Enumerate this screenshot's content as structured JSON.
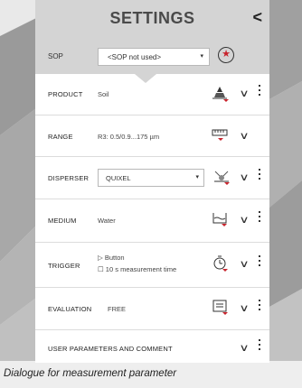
{
  "header": {
    "title": "SETTINGS",
    "back_label": "<"
  },
  "sop": {
    "label": "SOP",
    "value": "<SOP not used>",
    "arrow": "▾"
  },
  "rows": [
    {
      "label": "PRODUCT",
      "value": "Soil",
      "icon": "product-icon"
    },
    {
      "label": "RANGE",
      "value": "R3: 0.5/0.9...175 µm",
      "icon": "range-icon"
    },
    {
      "label": "DISPERSER",
      "value": "QUIXEL",
      "icon": "disperser-icon"
    },
    {
      "label": "MEDIUM",
      "value": "Water",
      "icon": "medium-icon"
    },
    {
      "label": "TRIGGER",
      "value_line1": "▷ Button",
      "value_line2": "☐ 10 s measurement time",
      "icon": "trigger-icon"
    },
    {
      "label": "EVALUATION",
      "value": "FREE",
      "icon": "evaluation-icon"
    },
    {
      "label": "USER PARAMETERS AND COMMENT"
    }
  ],
  "chevron": "∨",
  "caption": "Dialogue for measurement parameter",
  "colors": {
    "accent": "#c8232c",
    "header_bg": "#d4d4d4"
  }
}
